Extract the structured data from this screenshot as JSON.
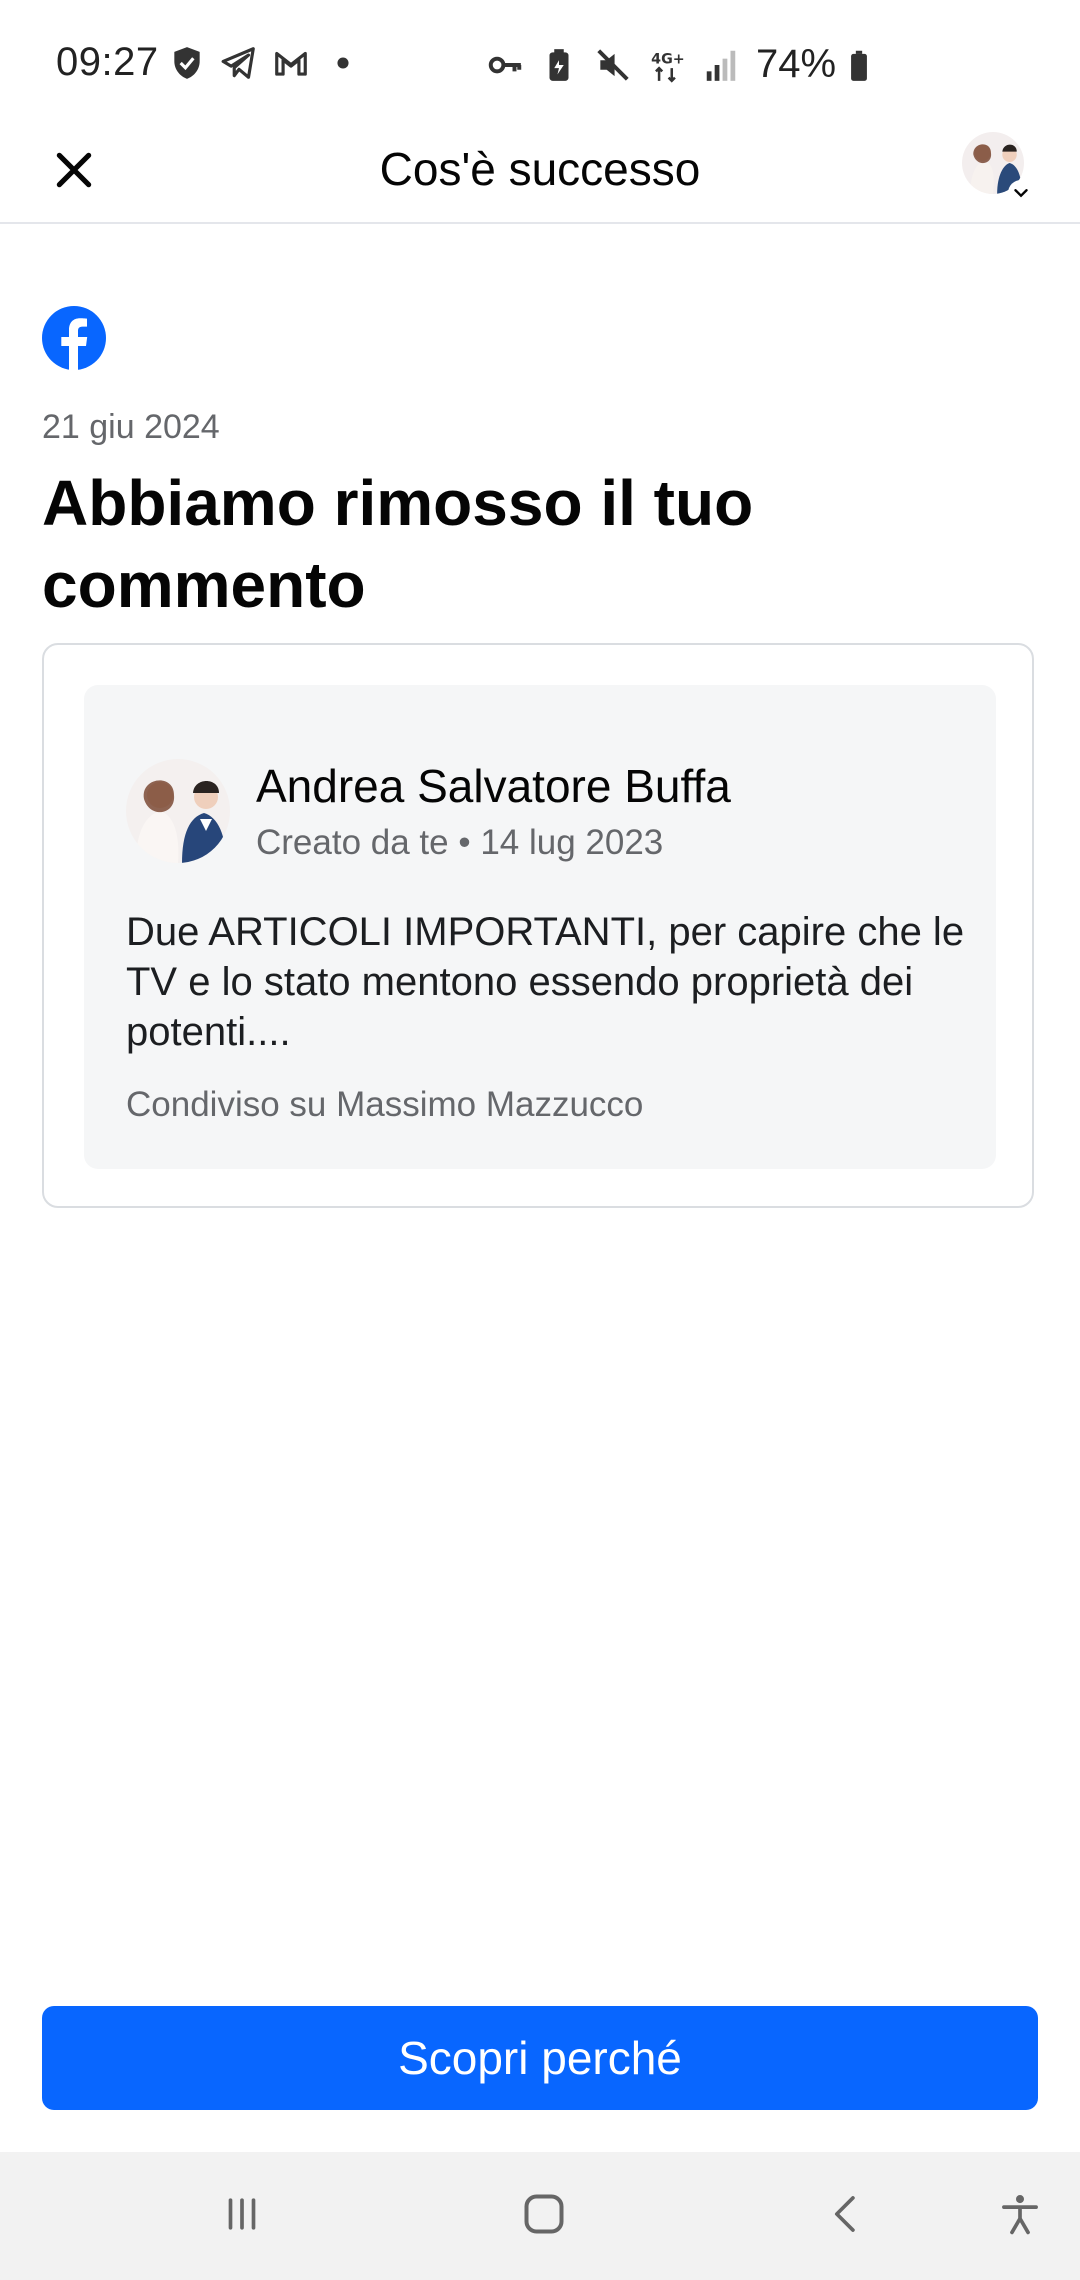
{
  "status_bar": {
    "time": "09:27",
    "battery": "74%",
    "left_icons": [
      "shield-icon",
      "telegram-icon",
      "gmail-icon",
      "dot-icon"
    ],
    "right_icons": [
      "key-icon",
      "battery-saver-icon",
      "mute-icon",
      "4g-data-icon",
      "signal-icon",
      "battery-icon"
    ]
  },
  "header": {
    "title": "Cos'è successo"
  },
  "notice": {
    "date": "21 giu 2024",
    "heading": "Abbiamo rimosso il tuo commento"
  },
  "post": {
    "author": "Andrea Salvatore Buffa",
    "meta": "Creato da te • 14 lug 2023",
    "text": "Due ARTICOLI IMPORTANTI, per capire che le TV e lo stato mentono essendo proprietà dei potenti....",
    "shared_on": "Condiviso su Massimo Mazzucco"
  },
  "cta": {
    "label": "Scopri perché"
  },
  "colors": {
    "accent": "#0866ff",
    "facebook_blue": "#0866ff",
    "secondary_text": "#65676b",
    "card_bg": "#f5f6f7"
  }
}
